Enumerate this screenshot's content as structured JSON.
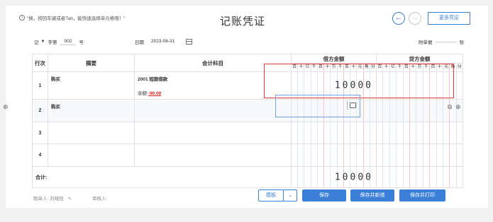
{
  "hint": {
    "icon": "info-icon",
    "text": "\"换，按回车键或者Tab，能快速选择单元格哦！\""
  },
  "title": "记账凭证",
  "nav": {
    "prev": "←",
    "next": "→",
    "more": "更多凭证"
  },
  "meta": {
    "voucher_word": "记",
    "voucher_no_label": "字第",
    "voucher_no": "002",
    "voucher_no_suffix": "号",
    "date_label": "日期",
    "date": "2023-08-31",
    "attach_label": "附单据",
    "attach_unit": "张"
  },
  "table": {
    "headers": {
      "row": "行次",
      "summary": "摘要",
      "subject": "会计科目",
      "debit": "借方金额",
      "credit": "贷方金额"
    },
    "digit_labels": [
      "百",
      "十",
      "亿",
      "千",
      "百",
      "十",
      "万",
      "千",
      "百",
      "十",
      "元",
      "角",
      "分"
    ],
    "rows": [
      {
        "no": "1",
        "summary": "购买",
        "subject": "2001 短期借款",
        "balance_label": "余额:",
        "balance": "-90.00",
        "debit": "10000"
      },
      {
        "no": "2",
        "summary": "购买",
        "subject": "",
        "balance_label": "",
        "balance": "",
        "debit": ""
      },
      {
        "no": "3",
        "summary": "",
        "subject": "",
        "debit": ""
      },
      {
        "no": "4",
        "summary": "",
        "subject": "",
        "debit": ""
      }
    ],
    "total_label": "合计:",
    "total_debit": "10000"
  },
  "footer": {
    "maker_label": "制单人:",
    "maker": "刘晓阳",
    "auditor_label": "审核人:"
  },
  "buttons": {
    "template": "模板",
    "save": "保存",
    "save_new": "保存并新增",
    "save_print": "保存并打印"
  },
  "colors": {
    "accent": "#3b7fd8",
    "highlight": "#e53935",
    "negative": "#e02020"
  }
}
